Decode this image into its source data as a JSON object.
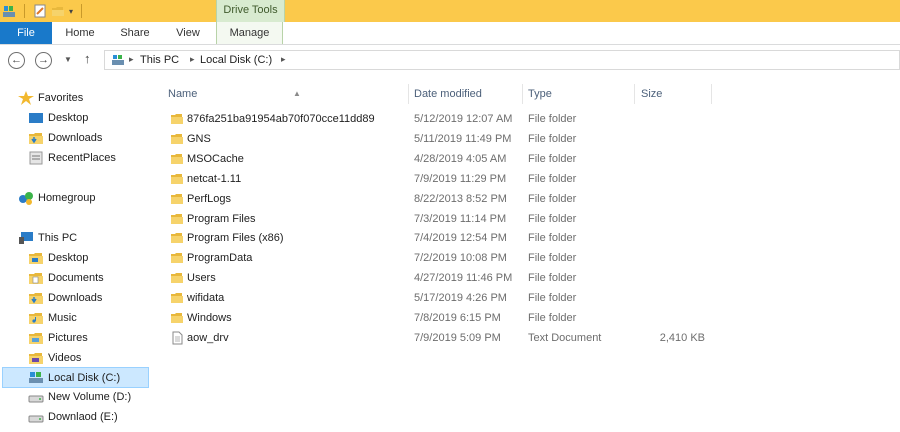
{
  "title_bar": {
    "context_tab": "Drive Tools"
  },
  "ribbon": {
    "tabs": [
      "File",
      "Home",
      "Share",
      "View",
      "Manage"
    ]
  },
  "address": {
    "crumbs": [
      "This PC",
      "Local Disk (C:)"
    ]
  },
  "nav_pane": {
    "favorites": {
      "label": "Favorites",
      "items": [
        "Desktop",
        "Downloads",
        "RecentPlaces"
      ]
    },
    "homegroup": {
      "label": "Homegroup"
    },
    "this_pc": {
      "label": "This PC",
      "items": [
        "Desktop",
        "Documents",
        "Downloads",
        "Music",
        "Pictures",
        "Videos",
        "Local Disk (C:)",
        "New Volume (D:)",
        "Downlaod (E:)"
      ]
    }
  },
  "columns": {
    "name": "Name",
    "date": "Date modified",
    "type": "Type",
    "size": "Size"
  },
  "files": [
    {
      "name": "876fa251ba91954ab70f070cce11dd89",
      "date": "5/12/2019 12:07 AM",
      "type": "File folder",
      "size": "",
      "icon": "folder-icon"
    },
    {
      "name": "GNS",
      "date": "5/11/2019 11:49 PM",
      "type": "File folder",
      "size": "",
      "icon": "folder-icon"
    },
    {
      "name": "MSOCache",
      "date": "4/28/2019 4:05 AM",
      "type": "File folder",
      "size": "",
      "icon": "folder-icon"
    },
    {
      "name": "netcat-1.11",
      "date": "7/9/2019 11:29 PM",
      "type": "File folder",
      "size": "",
      "icon": "folder-icon"
    },
    {
      "name": "PerfLogs",
      "date": "8/22/2013 8:52 PM",
      "type": "File folder",
      "size": "",
      "icon": "folder-icon"
    },
    {
      "name": "Program Files",
      "date": "7/3/2019 11:14 PM",
      "type": "File folder",
      "size": "",
      "icon": "folder-icon"
    },
    {
      "name": "Program Files (x86)",
      "date": "7/4/2019 12:54 PM",
      "type": "File folder",
      "size": "",
      "icon": "folder-icon"
    },
    {
      "name": "ProgramData",
      "date": "7/2/2019 10:08 PM",
      "type": "File folder",
      "size": "",
      "icon": "folder-icon"
    },
    {
      "name": "Users",
      "date": "4/27/2019 11:46 PM",
      "type": "File folder",
      "size": "",
      "icon": "folder-icon"
    },
    {
      "name": "wifidata",
      "date": "5/17/2019 4:26 PM",
      "type": "File folder",
      "size": "",
      "icon": "folder-icon"
    },
    {
      "name": "Windows",
      "date": "7/8/2019 6:15 PM",
      "type": "File folder",
      "size": "",
      "icon": "folder-icon"
    },
    {
      "name": "aow_drv",
      "date": "7/9/2019 5:09 PM",
      "type": "Text Document",
      "size": "2,410 KB",
      "icon": "text-document-icon"
    }
  ],
  "colors": {
    "title_bar": "#fbc94b",
    "file_tab": "#1979ca",
    "context_tab": "#d8ebd0",
    "selection": "#cce8ff"
  }
}
